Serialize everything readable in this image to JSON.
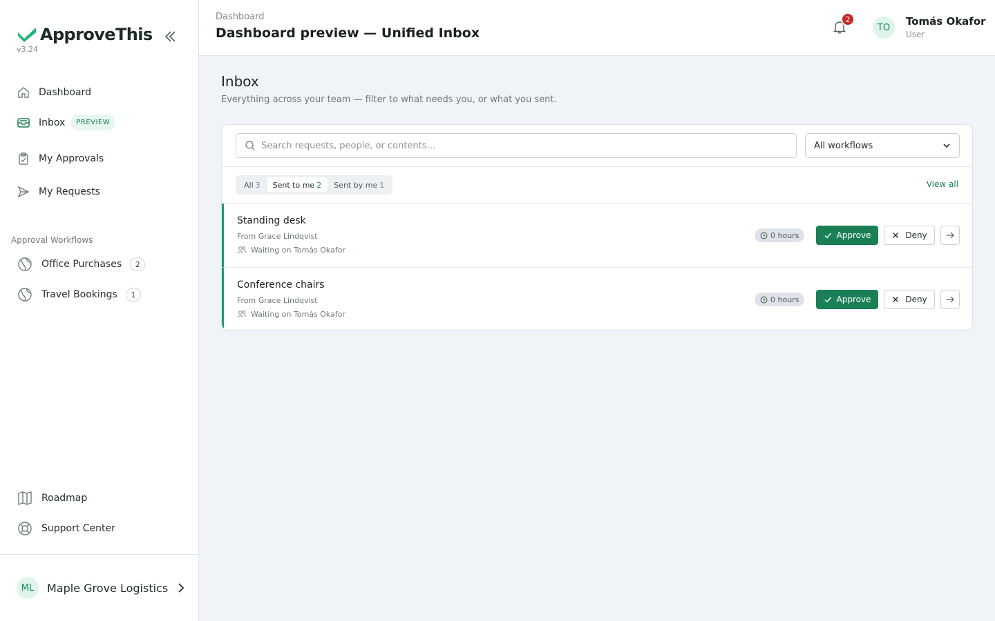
{
  "app": {
    "name": "ApproveThis",
    "version": "v3.24",
    "brand_color": "#1a7f55"
  },
  "sidebar": {
    "nav": [
      {
        "label": "Dashboard",
        "icon": "home-icon"
      },
      {
        "label": "Inbox",
        "icon": "inbox-icon",
        "badge": "PREVIEW"
      },
      {
        "label": "My Approvals",
        "icon": "clipboard-icon"
      },
      {
        "label": "My Requests",
        "icon": "send-icon"
      }
    ],
    "section_label": "Approval Workflows",
    "workflows": [
      {
        "label": "Office Purchases",
        "count": "2",
        "icon": "globe-icon"
      },
      {
        "label": "Travel Bookings",
        "count": "1",
        "icon": "globe-icon"
      }
    ],
    "bottom": [
      {
        "label": "Roadmap",
        "icon": "map-icon"
      },
      {
        "label": "Support Center",
        "icon": "lifebuoy-icon"
      }
    ],
    "org": {
      "initials": "ML",
      "name": "Maple Grove Logistics"
    }
  },
  "header": {
    "breadcrumb": "Dashboard",
    "title": "Dashboard preview — Unified Inbox",
    "notification_count": "2",
    "user": {
      "initials": "TO",
      "name": "Tomás Okafor",
      "role": "User"
    }
  },
  "main": {
    "title": "Inbox",
    "subtitle": "Everything across your team — filter to what needs you, or what you sent.",
    "search_placeholder": "Search requests, people, or contents…",
    "workflow_filter": "All workflows",
    "tabs": [
      {
        "label": "All",
        "count": "3",
        "active": false
      },
      {
        "label": "Sent to me",
        "count": "2",
        "active": true
      },
      {
        "label": "Sent by me",
        "count": "1",
        "active": false
      }
    ],
    "view_all": "View all",
    "requests": [
      {
        "title": "Standing desk",
        "from": "From Grace Lindqvist",
        "waiting": "Waiting on Tomás Okafor",
        "age": "0 hours",
        "approve": "Approve",
        "deny": "Deny"
      },
      {
        "title": "Conference chairs",
        "from": "From Grace Lindqvist",
        "waiting": "Waiting on Tomás Okafor",
        "age": "0 hours",
        "approve": "Approve",
        "deny": "Deny"
      }
    ]
  }
}
